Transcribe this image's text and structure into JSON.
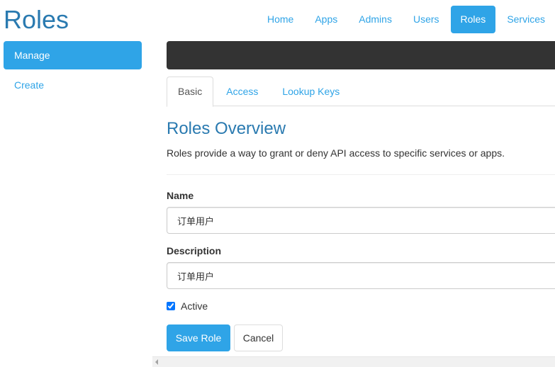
{
  "header": {
    "title": "Roles",
    "nav": [
      {
        "label": "Home",
        "active": false
      },
      {
        "label": "Apps",
        "active": false
      },
      {
        "label": "Admins",
        "active": false
      },
      {
        "label": "Users",
        "active": false
      },
      {
        "label": "Roles",
        "active": true
      },
      {
        "label": "Services",
        "active": false
      }
    ]
  },
  "sidebar": {
    "items": [
      {
        "label": "Manage",
        "active": true
      },
      {
        "label": "Create",
        "active": false
      }
    ]
  },
  "tabs": [
    {
      "label": "Basic",
      "active": true
    },
    {
      "label": "Access",
      "active": false
    },
    {
      "label": "Lookup Keys",
      "active": false
    }
  ],
  "section": {
    "title": "Roles Overview",
    "description": "Roles provide a way to grant or deny API access to specific services or apps."
  },
  "form": {
    "name_label": "Name",
    "name_value": "订单用户",
    "description_label": "Description",
    "description_value": "订单用户",
    "active_label": "Active",
    "active_checked": true,
    "save_label": "Save Role",
    "cancel_label": "Cancel"
  },
  "colors": {
    "accent": "#2fa4e7",
    "title": "#2a7ab0",
    "dark_bar": "#333333"
  }
}
